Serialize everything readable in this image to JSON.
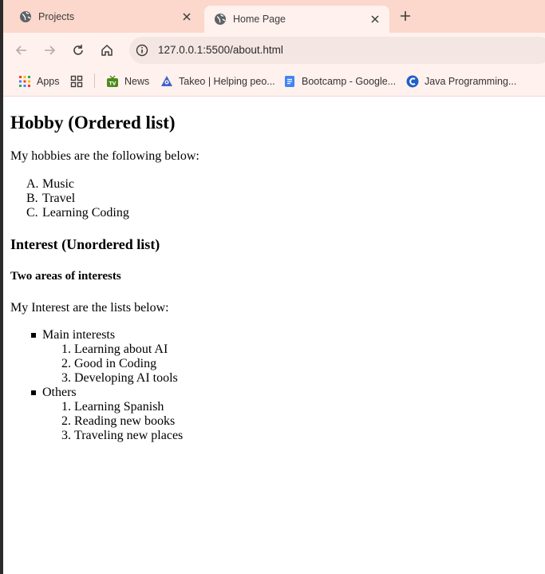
{
  "tabs": [
    {
      "title": "Projects",
      "active": false
    },
    {
      "title": "Home Page",
      "active": true
    }
  ],
  "toolbar": {
    "url": "127.0.0.1:5500/about.html"
  },
  "bookmarks": [
    {
      "label": "Apps",
      "icon": "apps-grid-icon"
    },
    {
      "label": "",
      "icon": "tab-groups-icon"
    },
    {
      "label": "News",
      "icon": "tv-icon"
    },
    {
      "label": "Takeo | Helping peo...",
      "icon": "takeo-icon"
    },
    {
      "label": "Bootcamp - Google...",
      "icon": "google-docs-icon"
    },
    {
      "label": "Java Programming...",
      "icon": "java-c-icon"
    }
  ],
  "page": {
    "h1": "Hobby (Ordered list)",
    "intro": "My hobbies are the following below:",
    "hobbies": [
      {
        "marker": "A.",
        "text": "Music"
      },
      {
        "marker": "B.",
        "text": "Travel"
      },
      {
        "marker": "C.",
        "text": "Learning Coding"
      }
    ],
    "h2": "Interest (Unordered list)",
    "h4": "Two areas of interests",
    "interest_intro": "My Interest are the lists below:",
    "interests": [
      {
        "label": "Main interests",
        "items": [
          {
            "marker": "1.",
            "text": "Learning about AI"
          },
          {
            "marker": "2.",
            "text": "Good in Coding"
          },
          {
            "marker": "3.",
            "text": "Developing AI tools"
          }
        ]
      },
      {
        "label": "Others",
        "items": [
          {
            "marker": "1.",
            "text": "Learning Spanish"
          },
          {
            "marker": "2.",
            "text": "Reading new books"
          },
          {
            "marker": "3.",
            "text": "Traveling new places"
          }
        ]
      }
    ]
  }
}
